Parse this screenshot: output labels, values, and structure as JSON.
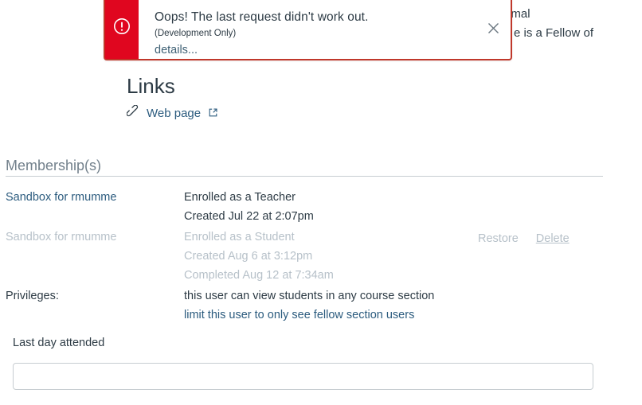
{
  "background_text": {
    "fragment_line_1": ", animal",
    "fragment_line_2": "e is a Fellow of"
  },
  "flash_banner": {
    "icon": "exclamation-circle-icon",
    "title": "Oops! The last request didn't work out.",
    "subtitle": "(Development Only)",
    "details_label": "details...",
    "close_icon": "close-icon",
    "accent_color": "#e0061f",
    "border_color": "#c0382b"
  },
  "links_section": {
    "heading": "Links",
    "link_icon": "chain-link-icon",
    "web_page_label": "Web page",
    "external_icon": "external-link-icon"
  },
  "membership_section": {
    "heading": "Membership(s)",
    "rows": [
      {
        "course": "Sandbox for rmumme",
        "enrollment": "Enrolled as a Teacher",
        "created": "Created Jul 22 at 2:07pm",
        "completed": "",
        "actions": [],
        "muted": false
      },
      {
        "course": "Sandbox for rmumme",
        "enrollment": "Enrolled as a Student",
        "created": "Created Aug 6 at 3:12pm",
        "completed": "Completed Aug 12 at 7:34am",
        "actions": [
          "Restore",
          "Delete"
        ],
        "muted": true
      }
    ]
  },
  "privileges": {
    "label": "Privileges:",
    "static_text": "this user can view students in any course section",
    "link_text": "limit this user to only see fellow section users"
  },
  "last_day_attended": {
    "label": "Last day attended",
    "value": "",
    "placeholder": ""
  }
}
